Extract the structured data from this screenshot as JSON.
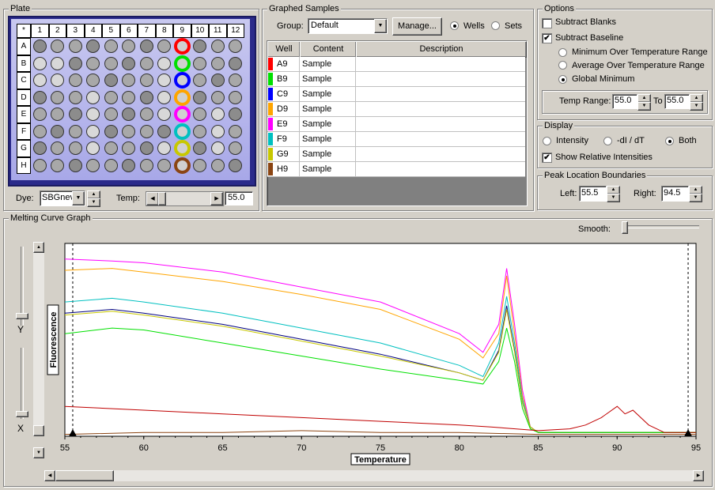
{
  "plate": {
    "title": "Plate",
    "corner": "*",
    "columns": [
      "1",
      "2",
      "3",
      "4",
      "5",
      "6",
      "7",
      "8",
      "9",
      "10",
      "11",
      "12"
    ],
    "rows": [
      "A",
      "B",
      "C",
      "D",
      "E",
      "F",
      "G",
      "H"
    ],
    "dye_label": "Dye:",
    "dye_value": "SBGnev",
    "temp_label": "Temp:",
    "temp_value": "55.0",
    "selected_column": "9"
  },
  "graphed": {
    "title": "Graphed Samples",
    "group_label": "Group:",
    "group_value": "Default",
    "manage_label": "Manage...",
    "wells_label": "Wells",
    "sets_label": "Sets",
    "headers": {
      "well": "Well",
      "content": "Content",
      "description": "Description"
    },
    "rows": [
      {
        "well": "A9",
        "content": "Sample",
        "description": "",
        "color": "#ff0000"
      },
      {
        "well": "B9",
        "content": "Sample",
        "description": "",
        "color": "#00e000"
      },
      {
        "well": "C9",
        "content": "Sample",
        "description": "",
        "color": "#0000ff"
      },
      {
        "well": "D9",
        "content": "Sample",
        "description": "",
        "color": "#ffa500"
      },
      {
        "well": "E9",
        "content": "Sample",
        "description": "",
        "color": "#ff00ff"
      },
      {
        "well": "F9",
        "content": "Sample",
        "description": "",
        "color": "#00c0c0"
      },
      {
        "well": "G9",
        "content": "Sample",
        "description": "",
        "color": "#c8c800"
      },
      {
        "well": "H9",
        "content": "Sample",
        "description": "",
        "color": "#8b4513"
      }
    ]
  },
  "options": {
    "title": "Options",
    "subtract_blanks": "Subtract Blanks",
    "subtract_baseline": "Subtract Baseline",
    "min_over": "Minimum Over Temperature Range",
    "avg_over": "Average Over Temperature Range",
    "global_min": "Global Minimum",
    "temp_range_label": "Temp Range:",
    "temp_from": "55.0",
    "to_label": "To",
    "temp_to": "55.0"
  },
  "display": {
    "title": "Display",
    "intensity": "Intensity",
    "didt": "-dI / dT",
    "both": "Both",
    "show_relative": "Show Relative Intensities"
  },
  "peak": {
    "title": "Peak Location Boundaries",
    "left_label": "Left:",
    "left_value": "55.5",
    "right_label": "Right:",
    "right_value": "94.5"
  },
  "melting": {
    "title": "Melting Curve Graph",
    "smooth_label": "Smooth:",
    "y_label": "Y",
    "x_label": "X"
  },
  "chart_data": {
    "type": "line",
    "xlabel": "Temperature",
    "ylabel": "Fluorescence",
    "xlim": [
      55,
      95
    ],
    "x_ticks": [
      "55",
      "60",
      "65",
      "70",
      "75",
      "80",
      "85",
      "90",
      "95"
    ],
    "series": [
      {
        "color": "#ff00ff",
        "x": [
          55,
          58,
          60,
          65,
          70,
          75,
          80,
          81.5,
          82.5,
          83,
          83.5,
          84,
          84.5,
          85,
          95
        ],
        "y": [
          0.95,
          0.94,
          0.93,
          0.88,
          0.8,
          0.72,
          0.55,
          0.45,
          0.6,
          0.9,
          0.6,
          0.25,
          0.05,
          0.02,
          0.02
        ]
      },
      {
        "color": "#ffa500",
        "x": [
          55,
          58,
          60,
          65,
          70,
          75,
          80,
          81.5,
          82.5,
          83,
          83.5,
          84,
          84.5,
          85,
          95
        ],
        "y": [
          0.89,
          0.9,
          0.88,
          0.83,
          0.76,
          0.68,
          0.52,
          0.42,
          0.55,
          0.86,
          0.55,
          0.22,
          0.05,
          0.02,
          0.02
        ]
      },
      {
        "color": "#00c0c0",
        "x": [
          55,
          58,
          60,
          65,
          70,
          75,
          80,
          81.5,
          82.5,
          83,
          83.5,
          84,
          84.5,
          85,
          95
        ],
        "y": [
          0.72,
          0.74,
          0.72,
          0.66,
          0.58,
          0.5,
          0.38,
          0.32,
          0.5,
          0.75,
          0.5,
          0.2,
          0.05,
          0.02,
          0.02
        ]
      },
      {
        "color": "#000080",
        "x": [
          55,
          58,
          60,
          65,
          70,
          75,
          80,
          81.5,
          82.5,
          83,
          83.5,
          84,
          84.5,
          85,
          95
        ],
        "y": [
          0.66,
          0.68,
          0.66,
          0.6,
          0.52,
          0.44,
          0.34,
          0.3,
          0.46,
          0.7,
          0.46,
          0.18,
          0.05,
          0.02,
          0.02
        ]
      },
      {
        "color": "#c8c800",
        "x": [
          55,
          58,
          60,
          65,
          70,
          75,
          80,
          81.5,
          82.5,
          83,
          83.5,
          84,
          84.5,
          85,
          95
        ],
        "y": [
          0.65,
          0.67,
          0.65,
          0.59,
          0.51,
          0.43,
          0.34,
          0.3,
          0.45,
          0.68,
          0.45,
          0.18,
          0.05,
          0.02,
          0.02
        ]
      },
      {
        "color": "#00e000",
        "x": [
          55,
          58,
          60,
          65,
          70,
          75,
          80,
          81.5,
          82.5,
          83,
          83.5,
          84,
          84.5,
          85,
          95
        ],
        "y": [
          0.55,
          0.58,
          0.57,
          0.5,
          0.43,
          0.36,
          0.3,
          0.28,
          0.4,
          0.58,
          0.4,
          0.15,
          0.04,
          0.02,
          0.02
        ]
      },
      {
        "color": "#c00000",
        "x": [
          55,
          60,
          65,
          70,
          75,
          80,
          82,
          85,
          87,
          88,
          89,
          90,
          90.5,
          91,
          92,
          93,
          95
        ],
        "y": [
          0.16,
          0.14,
          0.12,
          0.1,
          0.08,
          0.06,
          0.05,
          0.03,
          0.04,
          0.06,
          0.1,
          0.16,
          0.12,
          0.14,
          0.06,
          0.02,
          0.02
        ]
      },
      {
        "color": "#8b4513",
        "x": [
          55,
          60,
          65,
          70,
          75,
          80,
          85,
          95
        ],
        "y": [
          0.01,
          0.02,
          0.02,
          0.03,
          0.02,
          0.02,
          0.01,
          0.01
        ]
      }
    ]
  }
}
